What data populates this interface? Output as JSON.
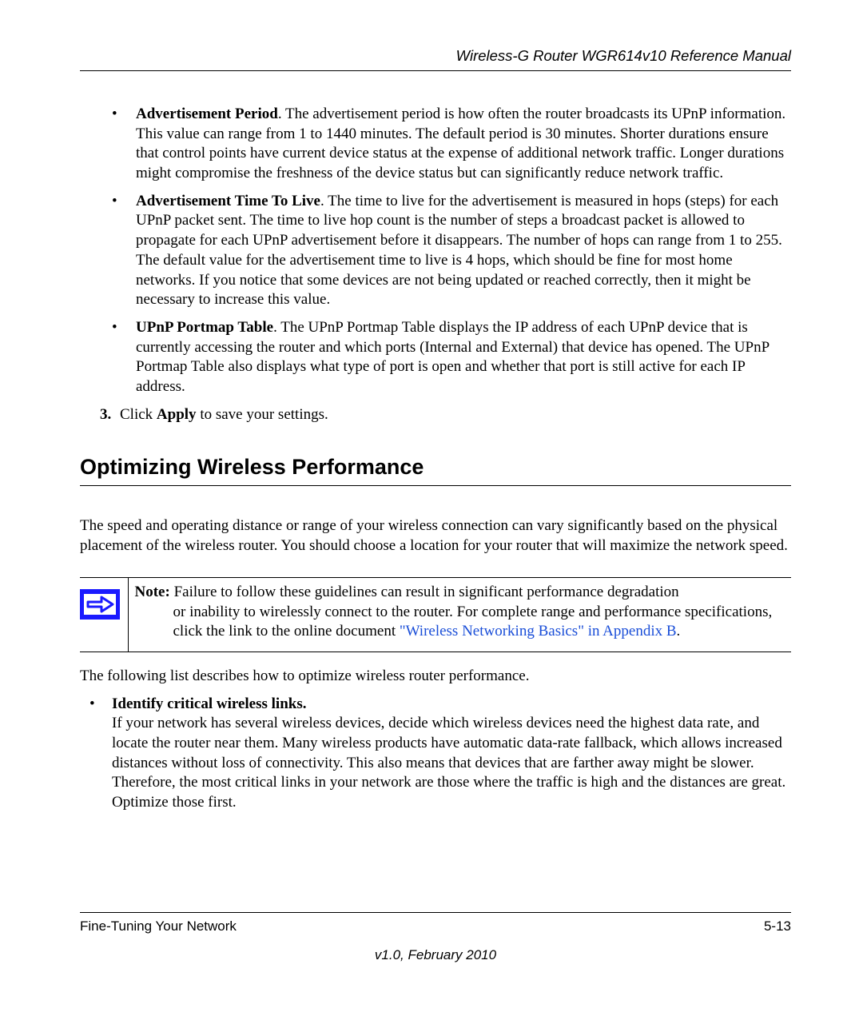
{
  "header": {
    "title": "Wireless-G Router WGR614v10 Reference Manual"
  },
  "bullets": [
    {
      "term": "Advertisement Period",
      "desc": ". The advertisement period is how often the router broadcasts its UPnP information. This value can range from 1 to 1440 minutes. The default period is 30 minutes. Shorter durations ensure that control points have current device status at the expense of additional network traffic. Longer durations might compromise the freshness of the device status but can significantly reduce network traffic."
    },
    {
      "term": "Advertisement Time To Live",
      "desc": ". The time to live for the advertisement is measured in hops (steps) for each UPnP packet sent. The time to live hop count is the number of steps a broadcast packet is allowed to propagate for each UPnP advertisement before it disappears. The number of hops can range from 1 to 255. The default value for the advertisement time to live is 4 hops, which should be fine for most home networks. If you notice that some devices are not being updated or reached correctly, then it might be necessary to increase this value."
    },
    {
      "term": "UPnP Portmap Table",
      "desc": ". The UPnP Portmap Table displays the IP address of each UPnP device that is currently accessing the router and which ports (Internal and External) that device has opened. The UPnP Portmap Table also displays what type of port is open and whether that port is still active for each IP address."
    }
  ],
  "step3": {
    "num": "3.",
    "pre": "Click ",
    "bold": "Apply",
    "post": " to save your settings."
  },
  "section_heading": "Optimizing Wireless Performance",
  "intro": "The speed and operating distance or range of your wireless connection can vary significantly based on the physical placement of the wireless router. You should choose a location for your router that will maximize the network speed.",
  "note": {
    "label": "Note:",
    "line1_tail": " Failure to follow these guidelines can result in significant performance degradation",
    "line2": "or inability to wirelessly connect to the router. For complete range and performance specifications, click the link to the online document ",
    "link": "\"Wireless Networking Basics\" in Appendix B",
    "end": "."
  },
  "afterlist": "The following list describes how to optimize wireless router performance.",
  "optimize_items": [
    {
      "title": "Identify critical wireless links.",
      "body": "If your network has several wireless devices, decide which wireless devices need the highest data rate, and locate the router near them. Many wireless products have automatic data-rate fallback, which allows increased distances without loss of connectivity. This also means that devices that are farther away might be slower. Therefore, the most critical links in your network are those where the traffic is high and the distances are great. Optimize those first."
    }
  ],
  "footer": {
    "left": "Fine-Tuning Your Network",
    "right": "5-13",
    "version": "v1.0, February 2010"
  }
}
